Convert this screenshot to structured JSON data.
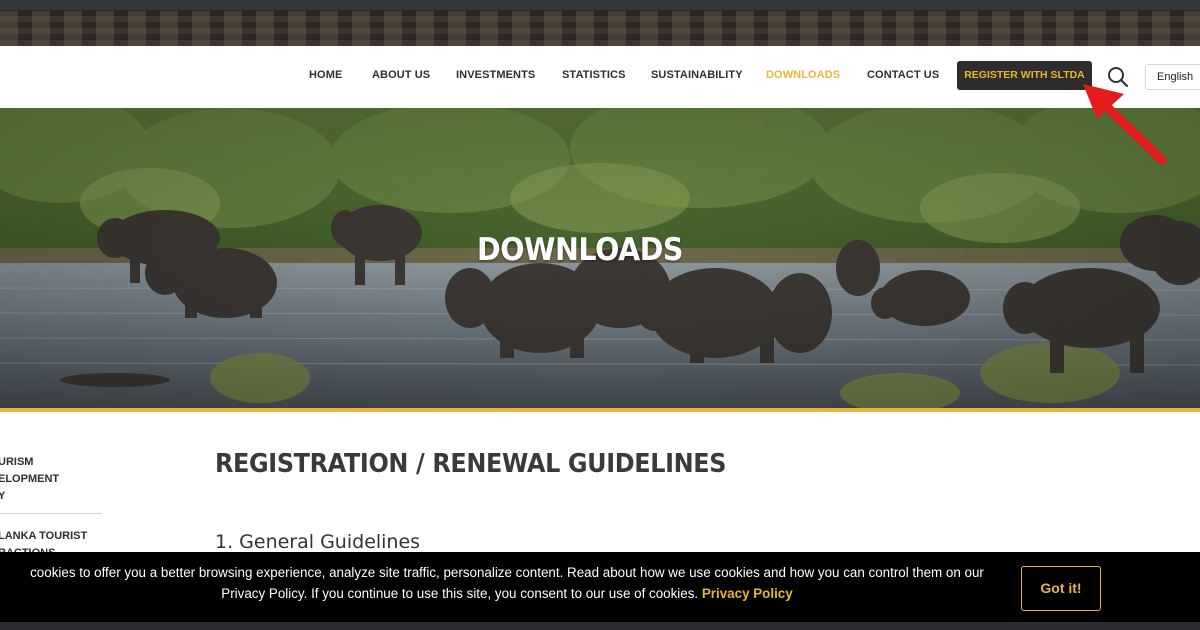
{
  "nav": {
    "items": [
      {
        "label": "HOME",
        "name": "nav-home"
      },
      {
        "label": "ABOUT US",
        "name": "nav-about-us"
      },
      {
        "label": "INVESTMENTS",
        "name": "nav-investments"
      },
      {
        "label": "STATISTICS",
        "name": "nav-statistics"
      },
      {
        "label": "SUSTAINABILITY",
        "name": "nav-sustainability"
      },
      {
        "label": "DOWNLOADS",
        "name": "nav-downloads",
        "active": true
      },
      {
        "label": "CONTACT US",
        "name": "nav-contact-us"
      }
    ],
    "register_label": "REGISTER WITH SLTDA",
    "search_icon": "search-icon",
    "language": "English"
  },
  "hero": {
    "title": "DOWNLOADS"
  },
  "sidebar": {
    "links": [
      "URISM\nELOPMENT\nY",
      "LANKA TOURIST\nRACTIONS"
    ]
  },
  "main": {
    "heading": "REGISTRATION / RENEWAL GUIDELINES",
    "section": "1. General Guidelines"
  },
  "cookie": {
    "line1": "cookies to offer you a better browsing experience, analyze site traffic, personalize content. Read about how we use cookies and how you can control them on our",
    "line2": "Privacy Policy. If you continue to use this site, you consent to our use of cookies.",
    "link": "Privacy Policy",
    "button": "Got it!"
  },
  "colors": {
    "accent": "#e9b43a",
    "dark": "#2f2c29",
    "annotation": "#e41b1b"
  }
}
